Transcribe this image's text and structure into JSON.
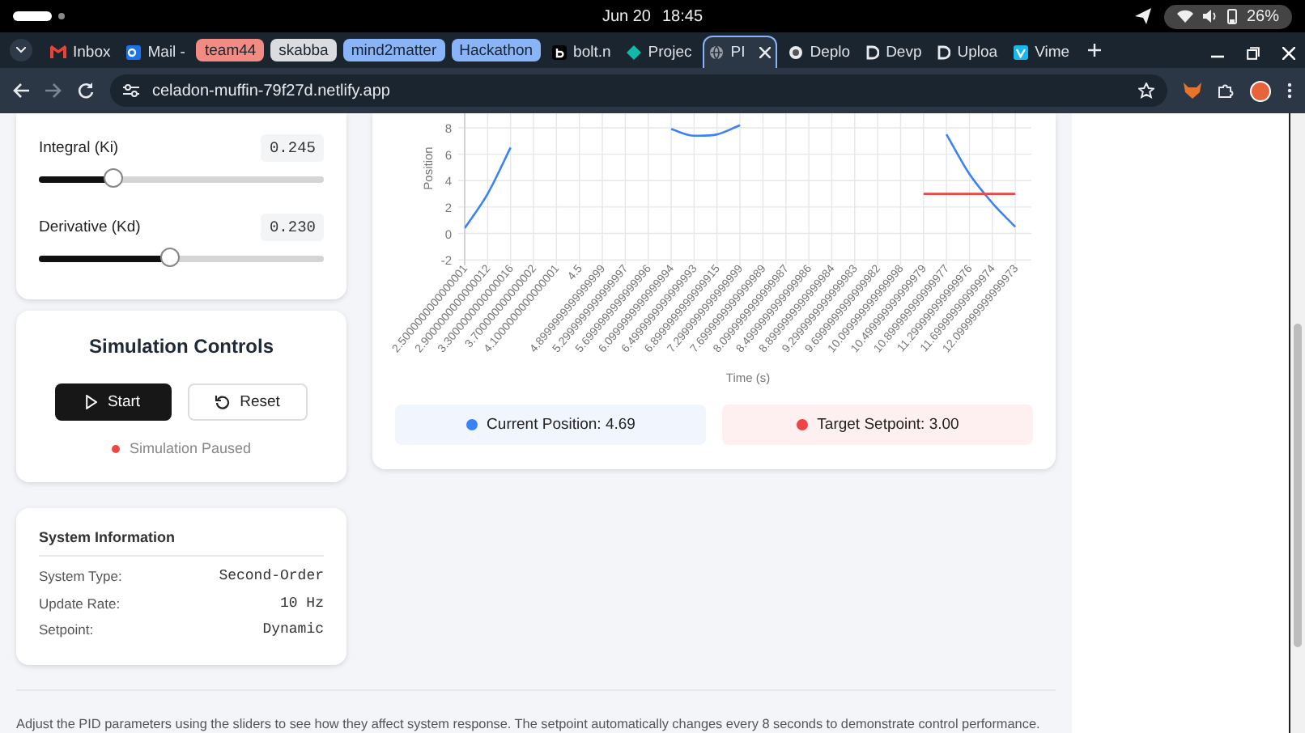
{
  "system_bar": {
    "date": "Jun 20",
    "time": "18:45",
    "battery": "26%"
  },
  "tab_strip": {
    "items": [
      {
        "kind": "tab",
        "label": "Inbox",
        "selected": false
      },
      {
        "kind": "tab",
        "label": "Mail -",
        "selected": false
      },
      {
        "kind": "group",
        "label": "team44",
        "color": "#f28b82"
      },
      {
        "kind": "group",
        "label": "skabba",
        "color": "#dadce0"
      },
      {
        "kind": "group",
        "label": "mind2matter",
        "color": "#8ab4f8"
      },
      {
        "kind": "group",
        "label": "Hackathon",
        "color": "#8ab4f8"
      },
      {
        "kind": "tab",
        "label": "bolt.n",
        "selected": false
      },
      {
        "kind": "tab",
        "label": "Projec",
        "selected": false
      },
      {
        "kind": "tab",
        "label": "PI",
        "selected": true
      },
      {
        "kind": "tab",
        "label": "Deplo",
        "selected": false
      },
      {
        "kind": "tab",
        "label": "Devp",
        "selected": false
      },
      {
        "kind": "tab",
        "label": "Uploa",
        "selected": false
      },
      {
        "kind": "tab",
        "label": "Vime",
        "selected": false
      }
    ]
  },
  "address_bar": {
    "url": "celadon-muffin-79f27d.netlify.app"
  },
  "pid_controls": {
    "sliders": [
      {
        "label": "Integral (Ki)",
        "value": "0.245",
        "level": 0.26
      },
      {
        "label": "Derivative (Kd)",
        "value": "0.230",
        "level": 0.46
      }
    ]
  },
  "simulation_controls": {
    "title": "Simulation Controls",
    "buttons": [
      {
        "kind": "primary",
        "label": "Start"
      },
      {
        "kind": "secondary",
        "label": "Reset"
      }
    ],
    "status": {
      "label": "Simulation Paused",
      "running": false
    }
  },
  "system_information": {
    "title": "System Information",
    "rows": [
      {
        "label": "System Type:",
        "value": "Second-Order"
      },
      {
        "label": "Update Rate:",
        "value": "10 Hz"
      },
      {
        "label": "Setpoint:",
        "value": "Dynamic"
      }
    ]
  },
  "chart": {
    "chart_data": {
      "type": "line",
      "grid": true,
      "xlabel": "Time (s)",
      "ylabel": "Position",
      "ylim": [
        -2,
        9.1
      ],
      "yticks": [
        -2,
        0,
        2,
        4,
        6,
        8
      ],
      "categories": [
        "2.5000000000000001",
        "2.9000000000000012",
        "3.3000000000000016",
        "3.700000000000002",
        "4.1000000000000001",
        "4.5",
        "4.8999999999999999",
        "5.2999999999999997",
        "5.6999999999999996",
        "6.0999999999999994",
        "6.4999999999999993",
        "6.8999999999999915",
        "7.2999999999999999",
        "7.6999999999999989",
        "8.0999999999999987",
        "8.4999999999999986",
        "8.8999999999999984",
        "9.2999999999999983",
        "9.6999999999999982",
        "10.099999999999998",
        "10.499999999999979",
        "10.899999999999977",
        "11.299999999999976",
        "11.699999999999974",
        "12.099999999999973"
      ],
      "series": [
        {
          "color": "#3b82f6",
          "values": [
            0.4,
            3,
            6.5,
            null,
            null,
            null,
            null,
            null,
            null,
            7.9,
            7.4,
            7.5,
            8.2,
            null,
            null,
            null,
            null,
            null,
            null,
            null,
            null,
            7.5,
            4.5,
            2.3,
            0.5
          ]
        },
        {
          "color": "#ef4444",
          "values": [
            null,
            null,
            null,
            null,
            null,
            null,
            null,
            null,
            null,
            null,
            null,
            null,
            null,
            null,
            null,
            null,
            null,
            null,
            null,
            null,
            3,
            3,
            3,
            3,
            3
          ]
        }
      ]
    },
    "legend": [
      {
        "label": "Current Position: 4.69",
        "color": "#3b82f6"
      },
      {
        "label": "Target Setpoint: 3.00",
        "color": "#ef4444"
      }
    ]
  },
  "footer": {
    "text": "Adjust the PID parameters using the sliders to see how they affect system response. The setpoint automatically changes every 8 seconds to demonstrate control performance."
  }
}
